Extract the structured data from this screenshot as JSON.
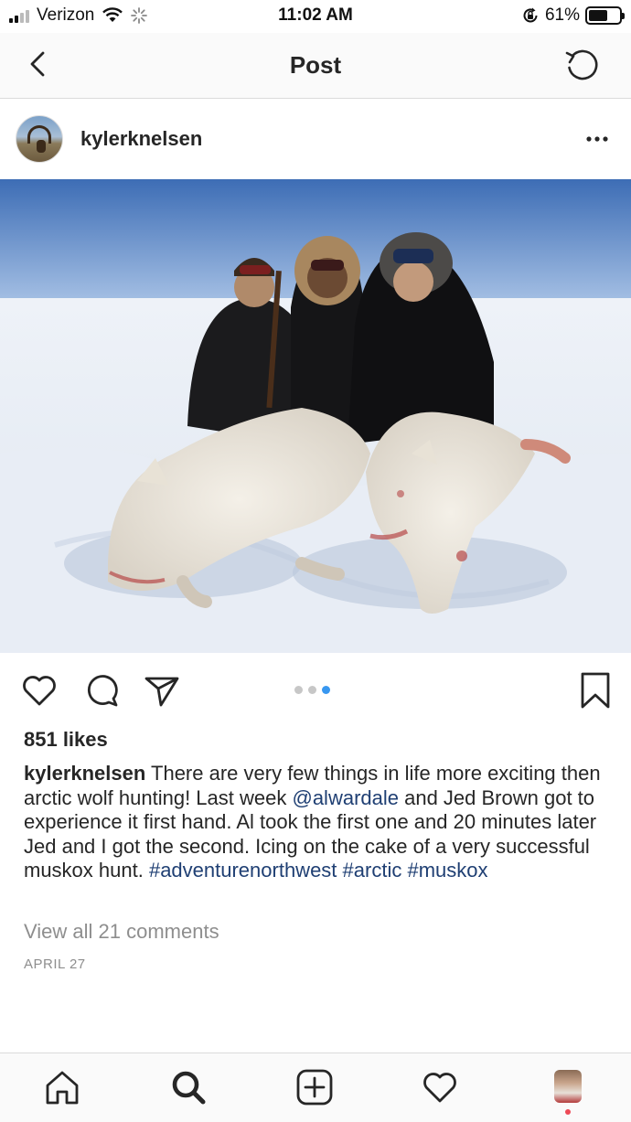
{
  "status_bar": {
    "carrier": "Verizon",
    "time": "11:02 AM",
    "battery_percent": "61%",
    "battery_level": 0.61,
    "icons": [
      "signal-icon",
      "wifi-icon",
      "loading-spinner-icon",
      "orientation-lock-icon",
      "battery-icon"
    ]
  },
  "nav": {
    "title": "Post",
    "back_icon": "chevron-left-icon",
    "refresh_icon": "refresh-icon"
  },
  "post": {
    "username": "kylerknelsen",
    "more_icon": "more-horizontal-icon",
    "carousel": {
      "total": 3,
      "active_index": 2
    },
    "likes": "851 likes",
    "caption": {
      "username": "kylerknelsen",
      "text_1": " There are very few things in life more exciting then arctic wolf hunting! Last week ",
      "mention": "@alwardale",
      "text_2": " and Jed Brown got to experience it first hand. Al took the first one and 20 minutes later Jed and I got the second.  Icing on the cake of a very successful muskox hunt. ",
      "hashtags": [
        "#adventurenorthwest",
        "#arctic",
        "#muskox"
      ]
    },
    "view_comments": "View all 21 comments",
    "date": "APRIL 27"
  },
  "actions": {
    "icons": [
      "heart-icon",
      "comment-icon",
      "share-icon",
      "bookmark-icon"
    ]
  },
  "tabbar": {
    "icons": [
      "home-icon",
      "search-icon",
      "add-post-icon",
      "activity-heart-icon",
      "profile-avatar"
    ]
  },
  "colors": {
    "link": "#1f3f73",
    "muted": "#8e8e8e",
    "carousel_active": "#3897f0",
    "notification_dot": "#ed4956"
  }
}
